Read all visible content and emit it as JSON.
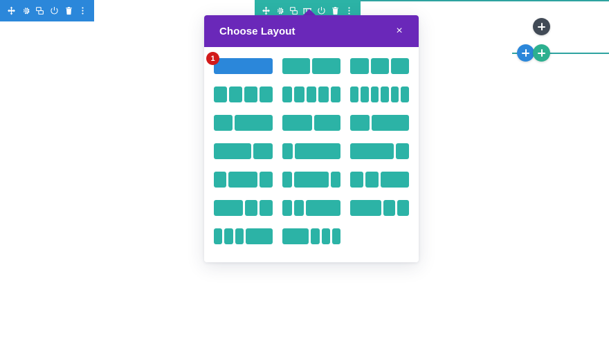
{
  "canvas": {
    "guide_color": "#2ea3a0",
    "background": "#ffffff"
  },
  "module_toolbar": {
    "name": "module-toolbar",
    "background": "#2b87da",
    "icons": [
      {
        "name": "move-icon",
        "label": "Move"
      },
      {
        "name": "gear-icon",
        "label": "Settings"
      },
      {
        "name": "duplicate-icon",
        "label": "Duplicate"
      },
      {
        "name": "power-icon",
        "label": "Disable"
      },
      {
        "name": "trash-icon",
        "label": "Delete"
      },
      {
        "name": "more-options-icon",
        "label": "More Options"
      }
    ]
  },
  "row_toolbar": {
    "name": "row-toolbar",
    "background": "#2cb3a6",
    "active_icon": "columns-icon",
    "icons": [
      {
        "name": "move-icon",
        "label": "Move"
      },
      {
        "name": "gear-icon",
        "label": "Settings"
      },
      {
        "name": "duplicate-icon",
        "label": "Duplicate"
      },
      {
        "name": "columns-icon",
        "label": "Change Column Structure"
      },
      {
        "name": "power-icon",
        "label": "Disable"
      },
      {
        "name": "trash-icon",
        "label": "Delete"
      },
      {
        "name": "more-options-icon",
        "label": "More Options"
      }
    ]
  },
  "add_buttons": [
    {
      "name": "add-section-button",
      "icon": "plus-icon",
      "color": "#414a56",
      "label": "Add New Section"
    },
    {
      "name": "add-row-button",
      "icon": "plus-icon",
      "color": "#2b87da",
      "label": "Add New Row"
    },
    {
      "name": "add-module-button",
      "icon": "plus-icon",
      "color": "#2cb08f",
      "label": "Add New Module"
    }
  ],
  "modal": {
    "title": "Choose Layout",
    "close_label": "×",
    "header_color": "#6a28b9",
    "column_color": "#2cb3a6",
    "selected_color": "#2b87da",
    "badge_color": "#d21a1a",
    "selected_index": 0,
    "selected_badge": "1",
    "layouts": [
      {
        "name": "layout-4-4-4",
        "label": "Fullwidth",
        "columns": [
          1
        ]
      },
      {
        "name": "layout-2-2",
        "label": "Half Half",
        "columns": [
          1,
          1
        ]
      },
      {
        "name": "layout-3-3-3",
        "label": "Third Third Third",
        "columns": [
          1,
          1,
          1
        ]
      },
      {
        "name": "layout-4-4-4-4",
        "label": "Four Columns",
        "columns": [
          1,
          1,
          1,
          1
        ]
      },
      {
        "name": "layout-5-5-5-5-5",
        "label": "Five Columns",
        "columns": [
          1,
          1,
          1,
          1,
          1
        ]
      },
      {
        "name": "layout-6-6-6-6-6-6",
        "label": "Six Columns",
        "columns": [
          1,
          1,
          1,
          1,
          1,
          1
        ]
      },
      {
        "name": "layout-third-twothirds",
        "label": "Third Two Thirds",
        "columns": [
          1,
          2
        ]
      },
      {
        "name": "layout-half-half-b",
        "label": "Half Half",
        "columns": [
          1.15,
          1
        ]
      },
      {
        "name": "layout-third-twothirds-b",
        "label": "Third Two Thirds",
        "columns": [
          1,
          1.9
        ]
      },
      {
        "name": "layout-twothirds-third",
        "label": "Two Thirds Third",
        "columns": [
          2,
          1
        ]
      },
      {
        "name": "layout-sixth-rest",
        "label": "Sixth Rest",
        "columns": [
          1,
          4.2
        ]
      },
      {
        "name": "layout-threequarter-quarter",
        "label": "Three Quarter Quarter",
        "columns": [
          3.4,
          1
        ]
      },
      {
        "name": "layout-quarter-half-quarter",
        "label": "Quarter Half Quarter",
        "columns": [
          1,
          2.3,
          1
        ]
      },
      {
        "name": "layout-sixth-twothirds-sixth",
        "label": "Sixth Two Thirds Sixth",
        "columns": [
          1,
          3.6,
          1
        ]
      },
      {
        "name": "layout-quarter-quarter-half",
        "label": "Quarter Quarter Half",
        "columns": [
          1,
          1,
          2.2
        ]
      },
      {
        "name": "layout-half-quarter-quarter",
        "label": "Half Quarter Quarter",
        "columns": [
          2.3,
          1,
          1
        ]
      },
      {
        "name": "layout-sixth-sixth-twothirds",
        "label": "Sixth Sixth Two Thirds",
        "columns": [
          1,
          1,
          3.6
        ]
      },
      {
        "name": "layout-half-sixth-sixth",
        "label": "Half Sixth Sixth",
        "columns": [
          2.6,
          1,
          1
        ]
      },
      {
        "name": "layout-sixth-sixth-sixth-half",
        "label": "Sixth Sixth Sixth Half",
        "columns": [
          1,
          1,
          1,
          3.1
        ]
      },
      {
        "name": "layout-half-sixth-sixth-sixth",
        "label": "Half Sixth Sixth Sixth",
        "columns": [
          3.1,
          1,
          1,
          1
        ]
      }
    ]
  }
}
